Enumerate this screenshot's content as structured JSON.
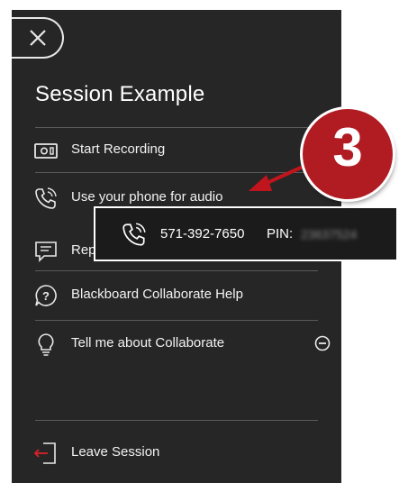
{
  "panel": {
    "title": "Session Example",
    "menu": [
      {
        "label": "Start Recording",
        "icon": "record-icon"
      },
      {
        "label": "Use your phone for audio",
        "icon": "phone-icon"
      },
      {
        "label": "Rep",
        "icon": "report-icon"
      },
      {
        "label": "Blackboard Collaborate Help",
        "icon": "help-icon"
      },
      {
        "label": "Tell me about Collaborate",
        "icon": "lightbulb-icon",
        "trailing_icon": "minus-circle-icon"
      }
    ],
    "leave": {
      "label": "Leave Session",
      "icon": "leave-icon"
    }
  },
  "popup": {
    "phone_number": "571-392-7650",
    "pin_label": "PIN:",
    "pin_value": "23637524"
  },
  "callout": {
    "number": "3",
    "color": "#b11c23"
  },
  "colors": {
    "panel_bg": "#262626",
    "text": "#f2f2f2",
    "divider": "#5a5a5a",
    "accent": "#b11c23",
    "leave_icon": "#d8232a"
  }
}
